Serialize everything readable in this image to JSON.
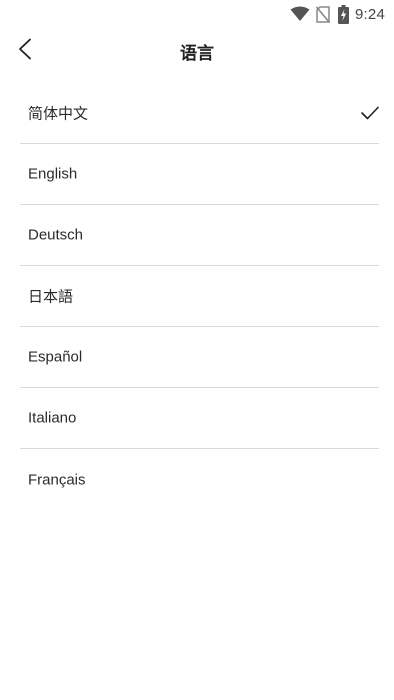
{
  "status_bar": {
    "time": "9:24",
    "icons": [
      "wifi-icon",
      "no-sim-icon",
      "battery-charging-icon"
    ]
  },
  "header": {
    "title": "语言",
    "back_icon": "chevron-left-icon"
  },
  "languages": [
    {
      "label": "简体中文",
      "selected": true
    },
    {
      "label": "English",
      "selected": false
    },
    {
      "label": "Deutsch",
      "selected": false
    },
    {
      "label": "日本語",
      "selected": false
    },
    {
      "label": "Español",
      "selected": false
    },
    {
      "label": "Italiano",
      "selected": false
    },
    {
      "label": "Français",
      "selected": false
    }
  ],
  "colors": {
    "background": "#ffffff",
    "divider": "#d9d9d9",
    "text": "#2b2b2b",
    "status_icons": "#555555"
  }
}
